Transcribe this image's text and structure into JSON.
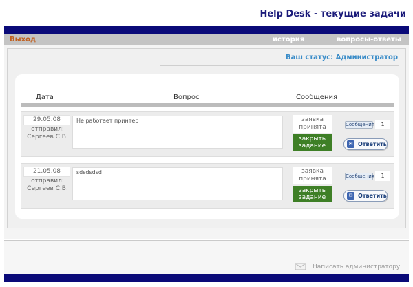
{
  "app": {
    "title": "Help Desk - текущие задачи"
  },
  "nav": {
    "exit": "Выход",
    "history": "история",
    "faq": "вопросы-ответы"
  },
  "status": {
    "text": "Ваш статус: Администратор"
  },
  "table": {
    "headers": {
      "date": "Дата",
      "question": "Вопрос",
      "messages": "Сообщения"
    },
    "rows": [
      {
        "date": "29.05.08",
        "sent_label": "отправил:",
        "sender": "Сергеев С.В.",
        "question": "Не работает принтер",
        "status": "заявка принята",
        "close_button": "закрыть задание",
        "messages_button": "Сообщения",
        "messages_count": "1",
        "reply_button": "Ответить"
      },
      {
        "date": "21.05.08",
        "sent_label": "отправил:",
        "sender": "Сергеев С.В.",
        "question": "sdsdsdsd",
        "status": "заявка принята",
        "close_button": "закрыть задание",
        "messages_button": "Сообщения",
        "messages_count": "1",
        "reply_button": "Ответить"
      }
    ]
  },
  "footer": {
    "write_admin": "Написать администратору",
    "icon": "mail-icon"
  },
  "colors": {
    "band": "#0a0a78",
    "title": "#1b1b7a",
    "exit": "#c06020",
    "status": "#3a8cc8",
    "close_button": "#3e7f26"
  }
}
